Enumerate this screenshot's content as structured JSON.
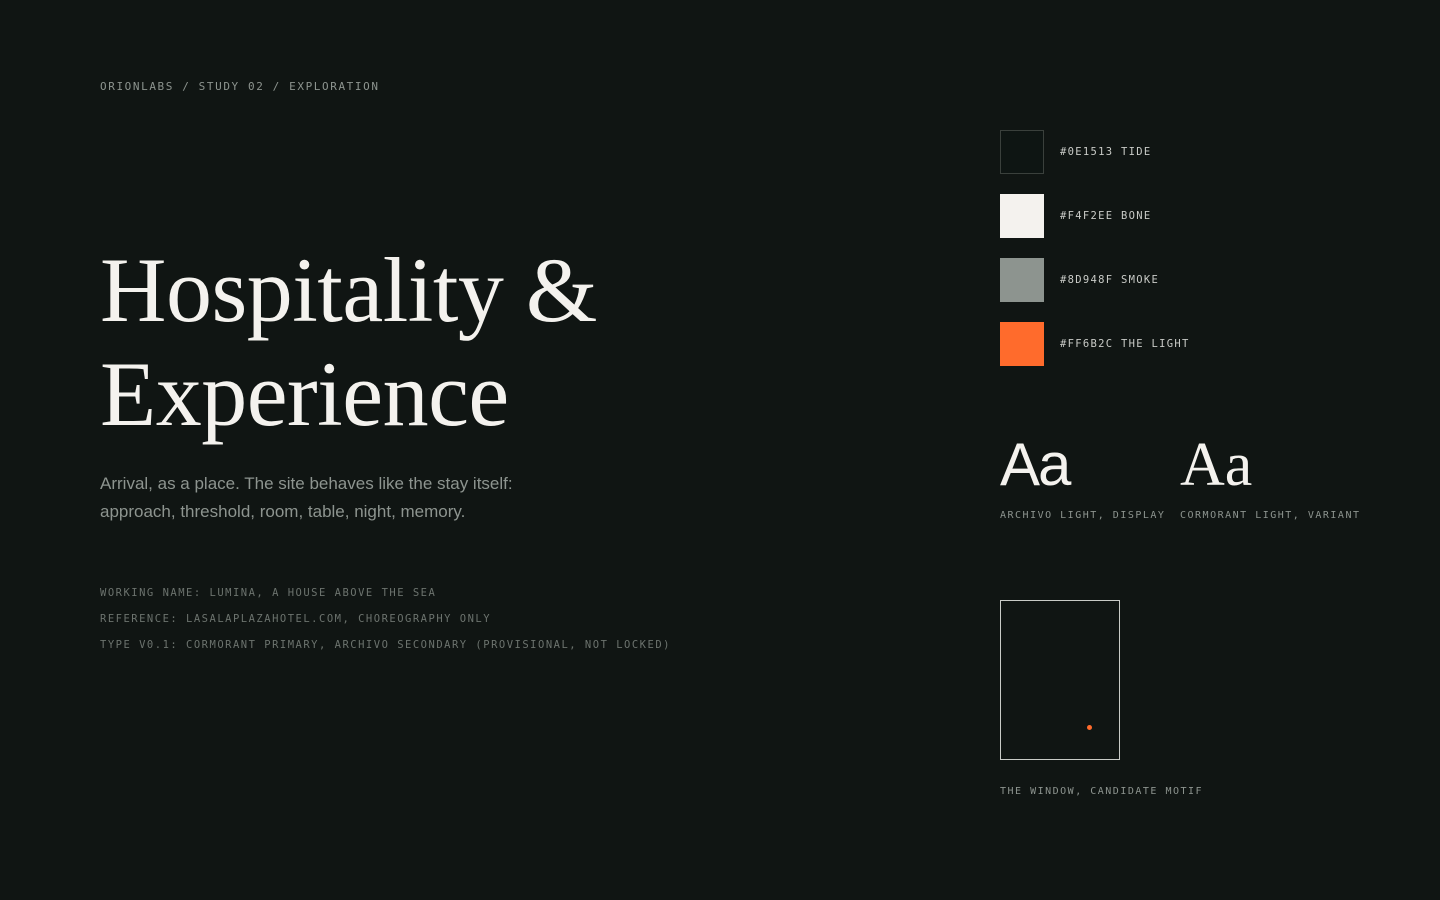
{
  "breadcrumb": "ORIONLABS / STUDY 02 / EXPLORATION",
  "title": {
    "line1": "Hospitality &",
    "line2": "Experience"
  },
  "subtitle": {
    "line1": "Arrival, as a place. The site behaves like the stay itself:",
    "line2": "approach, threshold, room, table, night, memory."
  },
  "notes": [
    "WORKING NAME: LUMINA, A HOUSE ABOVE THE SEA",
    "REFERENCE: LASALAPLAZAHOTEL.COM, CHOREOGRAPHY ONLY",
    "TYPE v0.1: CORMORANT PRIMARY, ARCHIVO SECONDARY (PROVISIONAL, NOT LOCKED)"
  ],
  "palette": [
    {
      "color": "#0E1513",
      "label": "#0E1513 TIDE"
    },
    {
      "color": "#F4F2EE",
      "label": "#F4F2EE BONE"
    },
    {
      "color": "#8D948F",
      "label": "#8D948F SMOKE"
    },
    {
      "color": "#FF6B2C",
      "label": "#FF6B2C THE LIGHT"
    }
  ],
  "type_specimens": {
    "sans": {
      "sample": "Aa",
      "caption": "ARCHIVO LIGHT, DISPLAY"
    },
    "serif": {
      "sample": "Aa",
      "caption": "CORMORANT LIGHT, VARIANT"
    }
  },
  "motif": {
    "caption": "THE WINDOW, CANDIDATE MOTIF",
    "accent_color": "#FF6B2C"
  }
}
